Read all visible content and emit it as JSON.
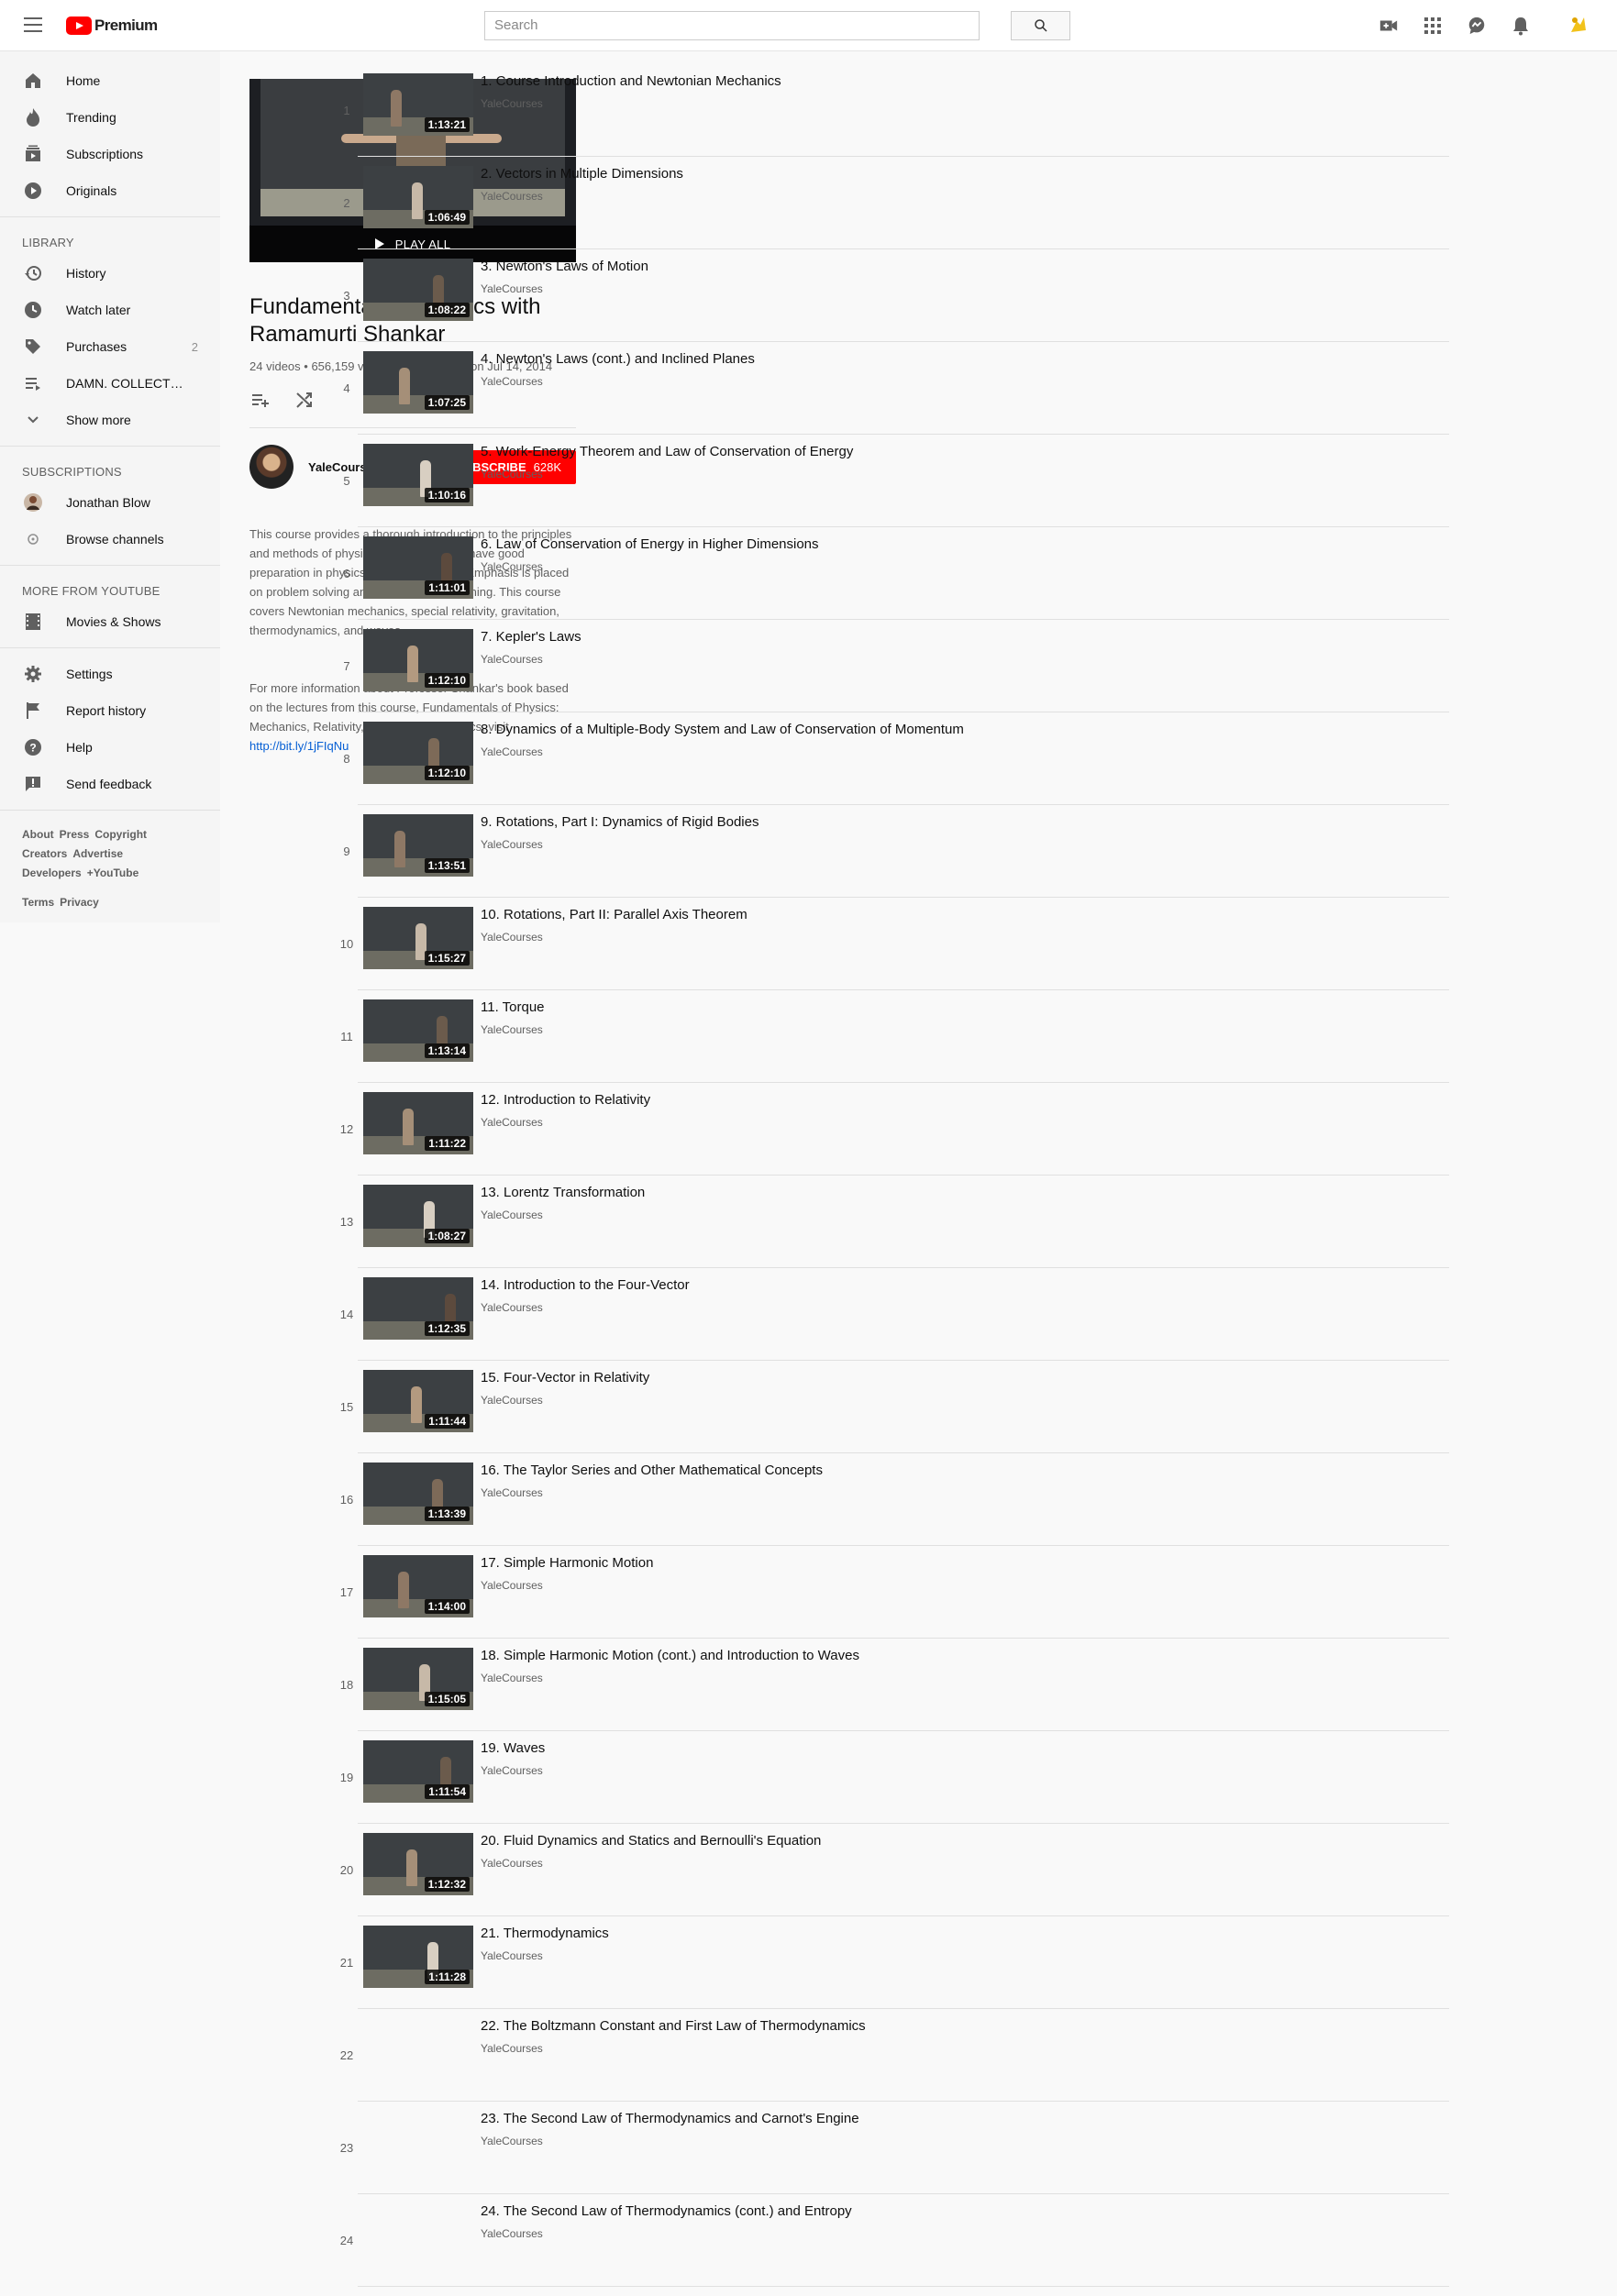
{
  "header": {
    "logo_text": "Premium",
    "search_placeholder": "Search"
  },
  "sidebar": {
    "main": [
      {
        "label": "Home",
        "icon": "home-icon"
      },
      {
        "label": "Trending",
        "icon": "trending-icon"
      },
      {
        "label": "Subscriptions",
        "icon": "subscriptions-icon"
      },
      {
        "label": "Originals",
        "icon": "originals-icon"
      }
    ],
    "library_heading": "LIBRARY",
    "library": [
      {
        "label": "History",
        "icon": "history-icon",
        "count": ""
      },
      {
        "label": "Watch later",
        "icon": "watch-later-icon",
        "count": ""
      },
      {
        "label": "Purchases",
        "icon": "purchases-icon",
        "count": "2"
      },
      {
        "label": "DAMN. COLLECT…",
        "icon": "playlist-icon",
        "count": ""
      },
      {
        "label": "Show more",
        "icon": "chevron-down-icon",
        "count": ""
      }
    ],
    "subscriptions_heading": "SUBSCRIPTIONS",
    "subscriptions": [
      {
        "label": "Jonathan Blow",
        "icon": "channel-avatar"
      },
      {
        "label": "Browse channels",
        "icon": "browse-channels-icon"
      }
    ],
    "more_heading": "MORE FROM YOUTUBE",
    "more": [
      {
        "label": "Movies & Shows",
        "icon": "movies-icon"
      }
    ],
    "settings": [
      {
        "label": "Settings",
        "icon": "gear-icon"
      },
      {
        "label": "Report history",
        "icon": "flag-icon"
      },
      {
        "label": "Help",
        "icon": "help-icon"
      },
      {
        "label": "Send feedback",
        "icon": "feedback-icon"
      }
    ],
    "footer_line1": [
      "About",
      "Press",
      "Copyright"
    ],
    "footer_line2": [
      "Creators",
      "Advertise"
    ],
    "footer_line3": [
      "Developers",
      "+YouTube"
    ],
    "footer_line4": [
      "Terms",
      "Privacy"
    ]
  },
  "playlist": {
    "play_all": "PLAY ALL",
    "title": "Fundamentals of Physics with Ramamurti Shankar",
    "video_count": "24 videos",
    "views": "656,159 views",
    "updated": "Last updated on Jul 14, 2014",
    "owner": "YaleCourses",
    "subscribe_label": "SUBSCRIBE",
    "subscriber_count": "628K",
    "description": "This course provides a thorough introduction to the principles and methods of physics for students who have good preparation in physics and mathematics. Emphasis is placed on problem solving and quantitative reasoning. This course covers Newtonian mechanics, special relativity, gravitation, thermodynamics, and waves.",
    "description2": "For more information about Professor Shankar's book based on the lectures from this course, Fundamentals of Physics: Mechanics, Relativity, and Thermodynamics, visit ",
    "link": "http://bit.ly/1jFIqNu"
  },
  "videos": [
    {
      "index": "1",
      "title": "1. Course Introduction and Newtonian Mechanics",
      "channel": "YaleCourses",
      "duration": "1:13:21"
    },
    {
      "index": "2",
      "title": "2. Vectors in Multiple Dimensions",
      "channel": "YaleCourses",
      "duration": "1:06:49"
    },
    {
      "index": "3",
      "title": "3. Newton's Laws of Motion",
      "channel": "YaleCourses",
      "duration": "1:08:22"
    },
    {
      "index": "4",
      "title": "4. Newton's Laws (cont.) and Inclined Planes",
      "channel": "YaleCourses",
      "duration": "1:07:25"
    },
    {
      "index": "5",
      "title": "5. Work-Energy Theorem and Law of Conservation of Energy",
      "channel": "YaleCourses",
      "duration": "1:10:16"
    },
    {
      "index": "6",
      "title": "6. Law of Conservation of Energy in Higher Dimensions",
      "channel": "YaleCourses",
      "duration": "1:11:01"
    },
    {
      "index": "7",
      "title": "7. Kepler's Laws",
      "channel": "YaleCourses",
      "duration": "1:12:10"
    },
    {
      "index": "8",
      "title": "8. Dynamics of a Multiple-Body System and Law of Conservation of Momentum",
      "channel": "YaleCourses",
      "duration": "1:12:10"
    },
    {
      "index": "9",
      "title": "9. Rotations, Part I: Dynamics of Rigid Bodies",
      "channel": "YaleCourses",
      "duration": "1:13:51"
    },
    {
      "index": "10",
      "title": "10. Rotations, Part II: Parallel Axis Theorem",
      "channel": "YaleCourses",
      "duration": "1:15:27"
    },
    {
      "index": "11",
      "title": "11. Torque",
      "channel": "YaleCourses",
      "duration": "1:13:14"
    },
    {
      "index": "12",
      "title": "12. Introduction to Relativity",
      "channel": "YaleCourses",
      "duration": "1:11:22"
    },
    {
      "index": "13",
      "title": "13. Lorentz Transformation",
      "channel": "YaleCourses",
      "duration": "1:08:27"
    },
    {
      "index": "14",
      "title": "14. Introduction to the Four-Vector",
      "channel": "YaleCourses",
      "duration": "1:12:35"
    },
    {
      "index": "15",
      "title": "15. Four-Vector in Relativity",
      "channel": "YaleCourses",
      "duration": "1:11:44"
    },
    {
      "index": "16",
      "title": "16. The Taylor Series and Other Mathematical Concepts",
      "channel": "YaleCourses",
      "duration": "1:13:39"
    },
    {
      "index": "17",
      "title": "17. Simple Harmonic Motion",
      "channel": "YaleCourses",
      "duration": "1:14:00"
    },
    {
      "index": "18",
      "title": "18. Simple Harmonic Motion (cont.) and Introduction to Waves",
      "channel": "YaleCourses",
      "duration": "1:15:05"
    },
    {
      "index": "19",
      "title": "19. Waves",
      "channel": "YaleCourses",
      "duration": "1:11:54"
    },
    {
      "index": "20",
      "title": "20. Fluid Dynamics and Statics and Bernoulli's Equation",
      "channel": "YaleCourses",
      "duration": "1:12:32"
    },
    {
      "index": "21",
      "title": "21. Thermodynamics",
      "channel": "YaleCourses",
      "duration": "1:11:28"
    },
    {
      "index": "22",
      "title": "22. The Boltzmann Constant and First Law of Thermodynamics",
      "channel": "YaleCourses",
      "duration": ""
    },
    {
      "index": "23",
      "title": "23. The Second Law of Thermodynamics and Carnot's Engine",
      "channel": "YaleCourses",
      "duration": ""
    },
    {
      "index": "24",
      "title": "24. The Second Law of Thermodynamics (cont.) and Entropy",
      "channel": "YaleCourses",
      "duration": ""
    }
  ],
  "colors": {
    "brand": "#ff0000",
    "link": "#065fd4"
  }
}
